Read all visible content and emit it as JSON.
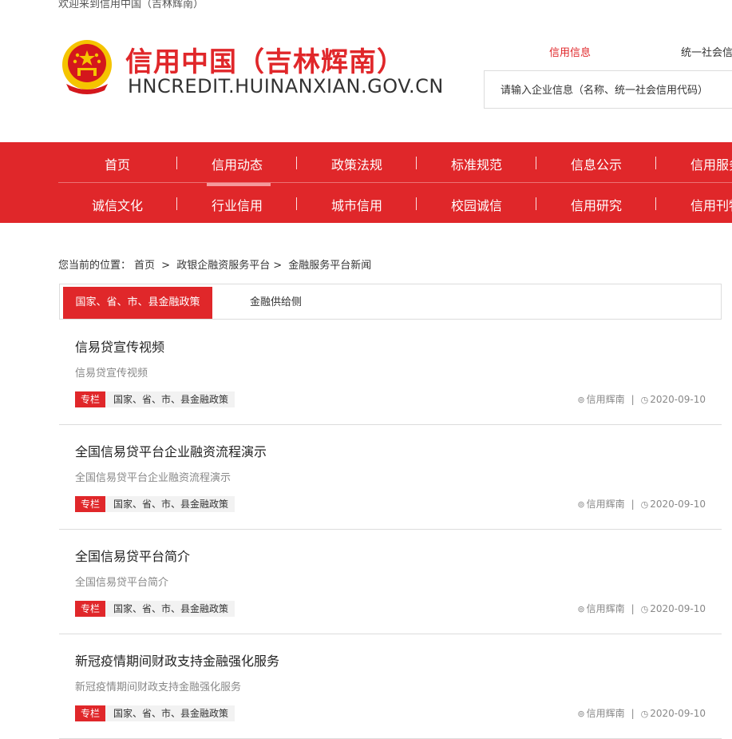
{
  "header": {
    "welcome": "欢迎来到信用中国（吉林辉南）",
    "site_name": "信用中国（吉林辉南）",
    "site_domain": "HNCREDIT.HUINANXIAN.GOV.CN",
    "top_links": [
      "信用信息",
      "统一社会信"
    ],
    "search_placeholder": "请输入企业信息（名称、统一社会信用代码）"
  },
  "nav": {
    "row1": [
      "首页",
      "信用动态",
      "政策法规",
      "标准规范",
      "信息公示",
      "信用服务"
    ],
    "row2": [
      "诚信文化",
      "行业信用",
      "城市信用",
      "校园诚信",
      "信用研究",
      "信用刊物"
    ],
    "active": "信用动态"
  },
  "breadcrumb": {
    "prefix": "您当前的位置：",
    "items": [
      "首页",
      ">",
      "政银企融资服务平台",
      ">",
      "金融服务平台新闻"
    ]
  },
  "tabs": {
    "active": "国家、省、市、县金融政策",
    "other": "金融供给侧"
  },
  "news": [
    {
      "title": "信易贷宣传视频",
      "summary": "信易贷宣传视频",
      "tag": "专栏",
      "category": "国家、省、市、县金融政策",
      "source": "信用辉南",
      "date": "2020-09-10"
    },
    {
      "title": "全国信易贷平台企业融资流程演示",
      "summary": "全国信易贷平台企业融资流程演示",
      "tag": "专栏",
      "category": "国家、省、市、县金融政策",
      "source": "信用辉南",
      "date": "2020-09-10"
    },
    {
      "title": "全国信易贷平台简介",
      "summary": "全国信易贷平台简介",
      "tag": "专栏",
      "category": "国家、省、市、县金融政策",
      "source": "信用辉南",
      "date": "2020-09-10"
    },
    {
      "title": "新冠疫情期间财政支持金融强化服务",
      "summary": "新冠疫情期间财政支持金融强化服务",
      "tag": "专栏",
      "category": "国家、省、市、县金融政策",
      "source": "信用辉南",
      "date": "2020-09-10"
    }
  ],
  "colors": {
    "brand_red": "#e0272a",
    "emblem_gold": "#f5c400"
  }
}
